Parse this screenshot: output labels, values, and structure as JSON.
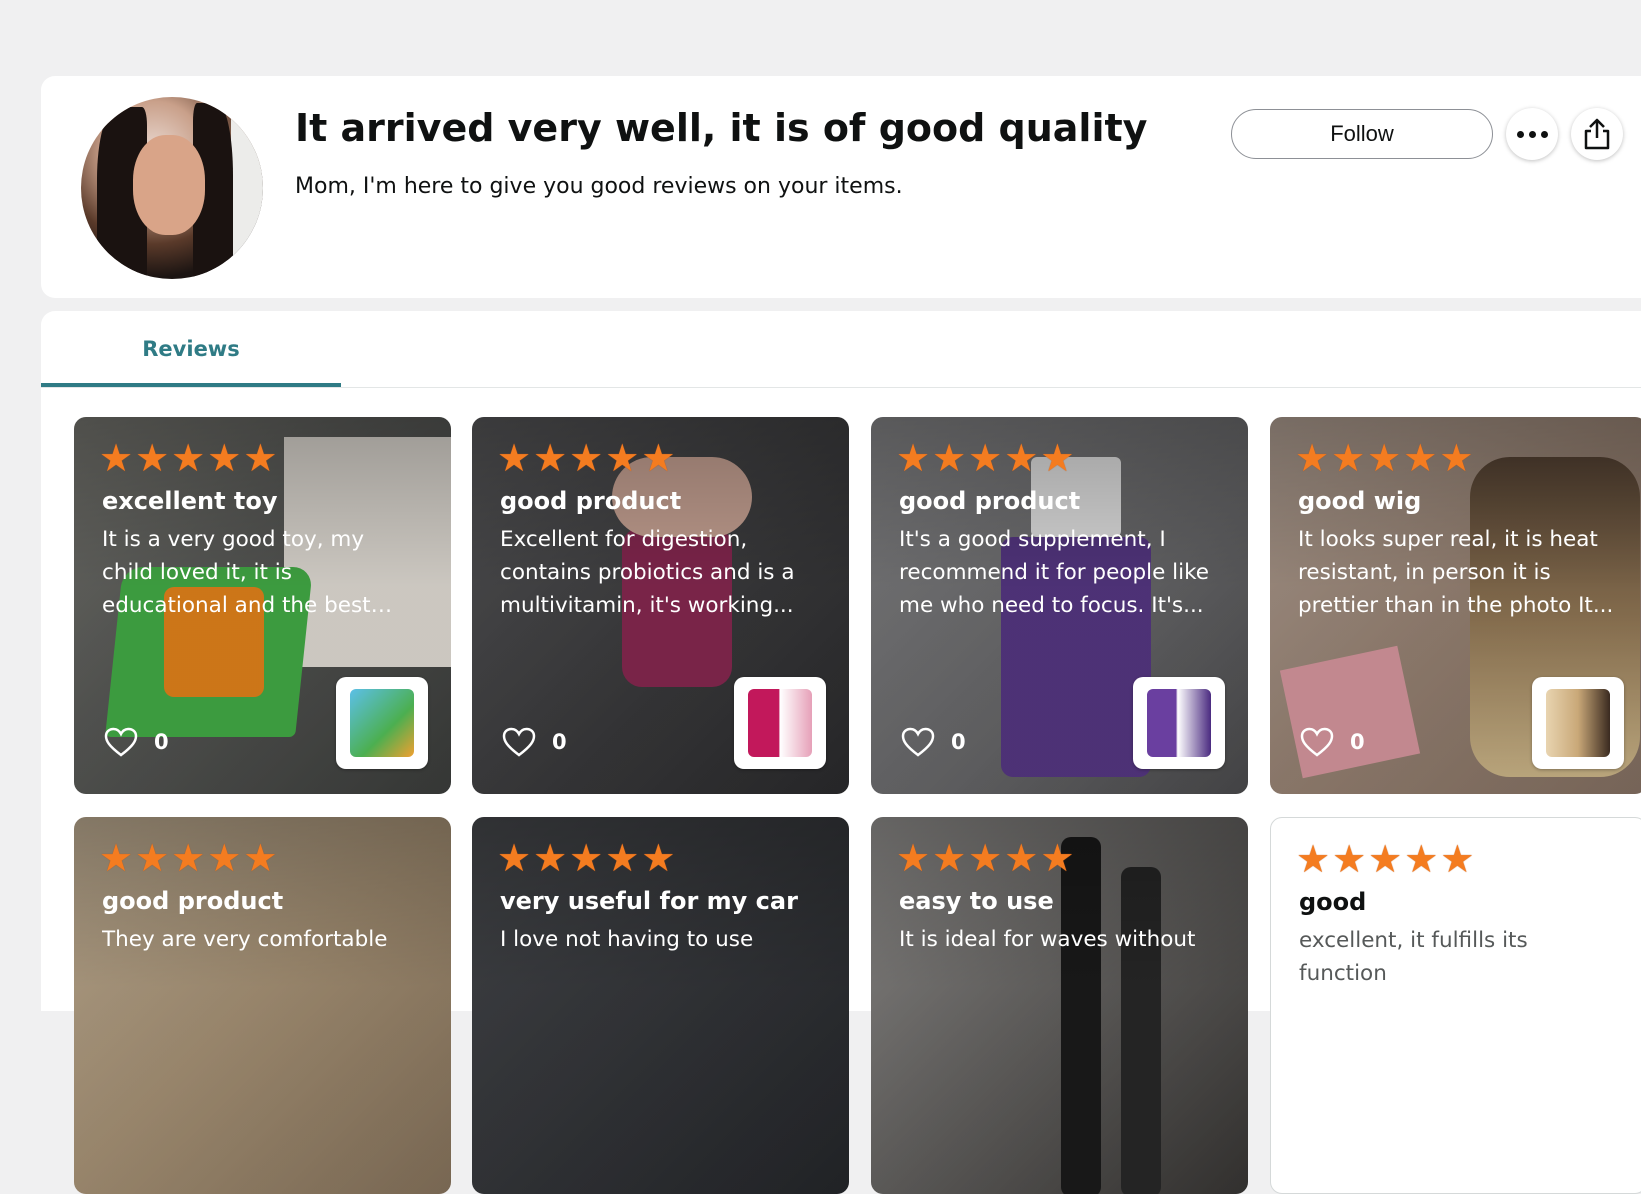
{
  "profile": {
    "name": "It arrived very well, it is of good quality",
    "bio": "Mom, I'm here to give you good reviews on your items.",
    "follow_label": "Follow",
    "more_icon": "more-horizontal-icon",
    "share_icon": "share-icon"
  },
  "tabs": [
    {
      "label": "Reviews",
      "active": true
    }
  ],
  "colors": {
    "accent": "#2f7b85",
    "star": "#f47c20"
  },
  "reviews": [
    {
      "rating": 5,
      "title": "excellent toy",
      "body": "It is a very good toy, my child loved it, it is educational and the best thing is that it is...",
      "likes": "0"
    },
    {
      "rating": 5,
      "title": "good product",
      "body": "Excellent for digestion, contains probiotics and is a multivitamin, it's working...",
      "likes": "0"
    },
    {
      "rating": 5,
      "title": "good product",
      "body": "It's a good supplement, I recommend it for people like me who need to focus. It's...",
      "likes": "0"
    },
    {
      "rating": 5,
      "title": "good wig",
      "body": "It looks super real, it is heat resistant, in person it is prettier than in the photo It...",
      "likes": "0"
    },
    {
      "rating": 5,
      "title": "good product",
      "body": "They are very comfortable"
    },
    {
      "rating": 5,
      "title": "very useful for my car",
      "body": "I love not having to use"
    },
    {
      "rating": 5,
      "title": "easy to use",
      "body": "It is ideal for waves without"
    },
    {
      "rating": 5,
      "title": "good",
      "body": "excellent, it fulfills its function"
    }
  ]
}
